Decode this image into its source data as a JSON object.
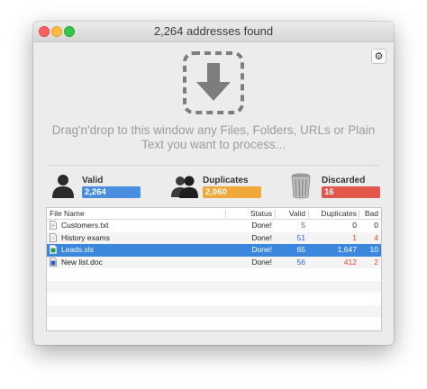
{
  "window": {
    "title": "2,264 addresses found"
  },
  "drop_zone": {
    "line1": "Drag'n'drop to this window any Files, Folders, URLs or Plain",
    "line2": "Text you want to process..."
  },
  "stats": [
    {
      "label": "Valid",
      "value": "2,264",
      "color": "#4a8ee0",
      "icon": "person-icon"
    },
    {
      "label": "Duplicates",
      "value": "2,060",
      "color": "#f0a83a",
      "icon": "people-icon"
    },
    {
      "label": "Discarded",
      "value": "16",
      "color": "#e2574c",
      "icon": "trash-icon"
    }
  ],
  "table": {
    "columns": [
      "File Name",
      "Status",
      "Valid",
      "Duplicates",
      "Bad"
    ],
    "rows": [
      {
        "name": "Customers.txt",
        "status": "Done!",
        "valid": "5",
        "duplicates": "0",
        "bad": "0",
        "icon": "text-file-icon"
      },
      {
        "name": "History exams",
        "status": "Done!",
        "valid": "51",
        "duplicates": "1",
        "bad": "4",
        "icon": "document-icon"
      },
      {
        "name": "Leads.xls",
        "status": "Done!",
        "valid": "65",
        "duplicates": "1,647",
        "bad": "10",
        "icon": "spreadsheet-icon"
      },
      {
        "name": "New list.doc",
        "status": "Done!",
        "valid": "56",
        "duplicates": "412",
        "bad": "2",
        "icon": "word-doc-icon"
      }
    ],
    "selected_row": 2
  },
  "colors": {
    "accent": "#3a87dd",
    "valid_text": "#2e6ad8",
    "bad_text": "#e04a2a"
  }
}
